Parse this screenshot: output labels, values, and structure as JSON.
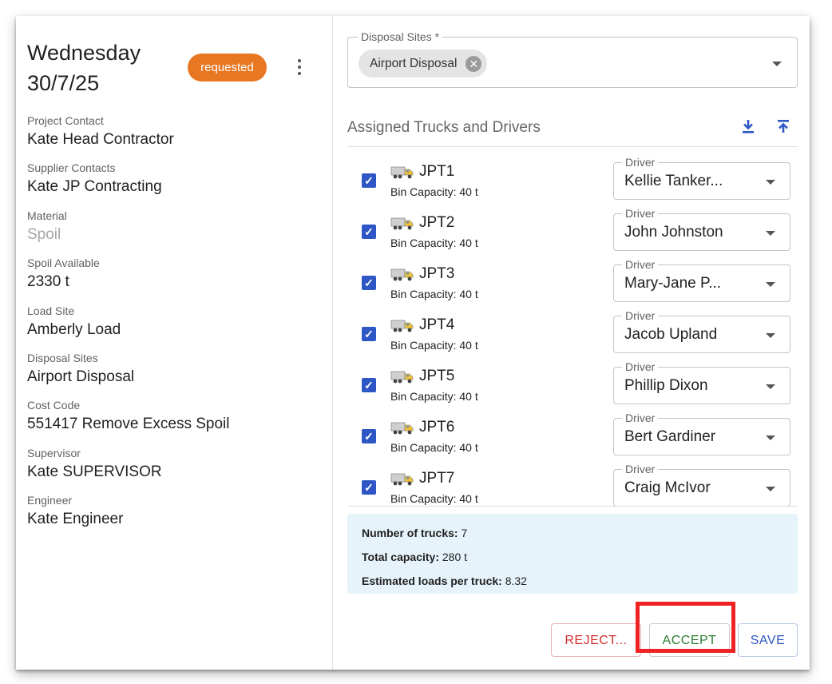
{
  "header": {
    "day": "Wednesday",
    "date": "30/7/25",
    "status": "requested"
  },
  "details": [
    {
      "label": "Project Contact",
      "value": "Kate Head Contractor"
    },
    {
      "label": "Supplier Contacts",
      "value": "Kate JP Contracting"
    },
    {
      "label": "Material",
      "value": "Spoil"
    },
    {
      "label": "Spoil Available",
      "value": "2330 t"
    },
    {
      "label": "Load Site",
      "value": "Amberly Load"
    },
    {
      "label": "Disposal Sites",
      "value": "Airport Disposal"
    },
    {
      "label": "Cost Code",
      "value": "551417 Remove Excess Spoil"
    },
    {
      "label": "Supervisor",
      "value": "Kate SUPERVISOR"
    },
    {
      "label": "Engineer",
      "value": "Kate Engineer"
    }
  ],
  "disposal": {
    "label": "Disposal Sites *",
    "chip": "Airport Disposal"
  },
  "assigned": {
    "title": "Assigned Trucks and Drivers",
    "driver_label": "Driver",
    "trucks": [
      {
        "name": "JPT1",
        "bin": "Bin Capacity: 40 t",
        "driver": "Kellie Tanker...",
        "checked": true
      },
      {
        "name": "JPT2",
        "bin": "Bin Capacity: 40 t",
        "driver": "John Johnston",
        "checked": true
      },
      {
        "name": "JPT3",
        "bin": "Bin Capacity: 40 t",
        "driver": "Mary-Jane P...",
        "checked": true
      },
      {
        "name": "JPT4",
        "bin": "Bin Capacity: 40 t",
        "driver": "Jacob Upland",
        "checked": true
      },
      {
        "name": "JPT5",
        "bin": "Bin Capacity: 40 t",
        "driver": "Phillip Dixon",
        "checked": true
      },
      {
        "name": "JPT6",
        "bin": "Bin Capacity: 40 t",
        "driver": "Bert Gardiner",
        "checked": true
      },
      {
        "name": "JPT7",
        "bin": "Bin Capacity: 40 t",
        "driver": "Craig McIvor",
        "checked": true
      }
    ]
  },
  "summary": {
    "trucks_label": "Number of trucks:",
    "trucks_value": "7",
    "capacity_label": "Total capacity:",
    "capacity_value": "280 t",
    "loads_label": "Estimated loads per truck:",
    "loads_value": "8.32"
  },
  "actions": {
    "reject": "REJECT...",
    "accept": "ACCEPT",
    "save": "SAVE"
  },
  "colors": {
    "badge": "#e87722",
    "accent": "#2e56c5",
    "reject": "#d32f2f",
    "accept": "#2e7d32",
    "highlight": "#ee2222",
    "summary_bg": "#e6f3fa"
  },
  "icons": {
    "download": "download-icon",
    "upload": "upload-icon",
    "truck": "truck-icon",
    "more": "more-vert-icon",
    "chip_remove": "cancel-icon"
  }
}
